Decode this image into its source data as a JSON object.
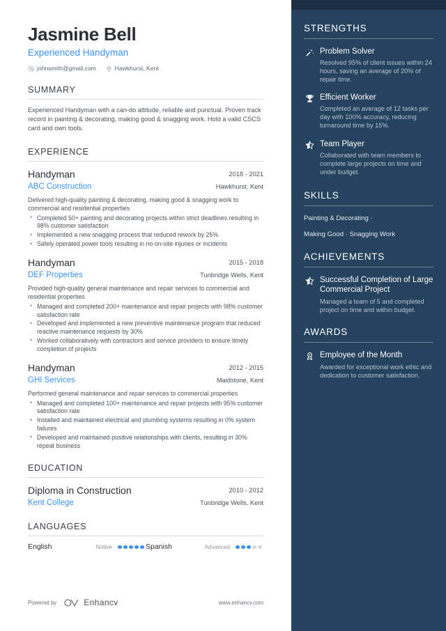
{
  "colors": {
    "sidebar_bg": "#25425e",
    "sidebar_top_band": "#1a2e42",
    "accent_blue": "#3b93f7",
    "heading_dark": "#2b2f36",
    "body_text": "#4b525b"
  },
  "header": {
    "name": "Jasmine Bell",
    "headline": "Experienced Handyman",
    "email": "johnsmith@gmail.com",
    "location": "Hawkhurst, Kent"
  },
  "summary": {
    "title": "SUMMARY",
    "text": "Experienced Handyman with a can-do attitude, reliable and punctual. Proven track record in painting & decorating, making good & snagging work. Hold a valid CSCS card and own tools."
  },
  "experience": {
    "title": "EXPERIENCE",
    "entries": [
      {
        "role": "Handyman",
        "org": "ABC Construction",
        "date": "2018 - 2021",
        "location": "Hawkhurst, Kent",
        "desc": "Delivered high-quality painting & decorating, making good & snagging work to commercial and residential properties",
        "bullets": [
          "Completed 50+ painting and decorating projects within strict deadlines resulting in 98% customer satisfaction",
          "Implemented a new snagging process that reduced rework by 25%",
          "Safely operated power tools resulting in no on-site injuries or incidents"
        ]
      },
      {
        "role": "Handyman",
        "org": "DEF Properties",
        "date": "2015 - 2018",
        "location": "Tunbridge Wells, Kent",
        "desc": "Provided high-quality general maintenance and repair services to commercial and residential properties",
        "bullets": [
          "Managed and completed 200+ maintenance and repair projects with 98% customer satisfaction rate",
          "Developed and implemented a new preventive maintenance program that reduced reactive maintenance requests by 30%",
          "Worked collaboratively with contractors and service providers to ensure timely completion of projects"
        ]
      },
      {
        "role": "Handyman",
        "org": "GHI Services",
        "date": "2012 - 2015",
        "location": "Maidstone, Kent",
        "desc": "Performed general maintenance and repair services to commercial properties",
        "bullets": [
          "Managed and completed 100+ maintenance and repair projects with 95% customer satisfaction rate",
          "Installed and maintained electrical and plumbing systems resulting in 0% system failures",
          "Developed and maintained positive relationships with clients, resulting in 30% repeat business"
        ]
      }
    ]
  },
  "education": {
    "title": "EDUCATION",
    "entries": [
      {
        "degree": "Diploma in Construction",
        "school": "Kent College",
        "date": "2010 - 2012",
        "location": "Tunbridge Wells, Kent"
      }
    ]
  },
  "languages": {
    "title": "LANGUAGES",
    "items": [
      {
        "name": "English",
        "level": "Native",
        "filled": 5,
        "total": 5
      },
      {
        "name": "Spanish",
        "level": "Advanced",
        "filled": 3,
        "total": 5
      }
    ]
  },
  "footer": {
    "powered_by": "Powered by",
    "brand": "Enhancv",
    "url": "www.enhancv.com"
  },
  "strengths": {
    "title": "STRENGTHS",
    "items": [
      {
        "icon": "magic-wand-icon",
        "title": "Problem Solver",
        "desc": "Resolved 95% of client issues within 24 hours, saving an average of 20% of repair time."
      },
      {
        "icon": "trophy-icon",
        "title": "Efficient Worker",
        "desc": "Completed an average of 12 tasks per day with 100% accuracy, reducing turnaround time by 15%."
      },
      {
        "icon": "star-icon",
        "title": "Team Player",
        "desc": "Collaborated with team members to complete large projects on time and under budget."
      }
    ]
  },
  "skills": {
    "title": "SKILLS",
    "lines": [
      "Painting & Decorating ·",
      "Making Good · Snagging Work"
    ]
  },
  "achievements": {
    "title": "ACHIEVEMENTS",
    "items": [
      {
        "icon": "star-icon",
        "title": "Successful Completion of Large Commercial Project",
        "desc": "Managed a team of 5 and completed project on time and within budget."
      }
    ]
  },
  "awards": {
    "title": "AWARDS",
    "items": [
      {
        "icon": "award-ribbon-icon",
        "title": "Employee of the Month",
        "desc": "Awarded for exceptional work ethic and dedication to customer satisfaction."
      }
    ]
  }
}
